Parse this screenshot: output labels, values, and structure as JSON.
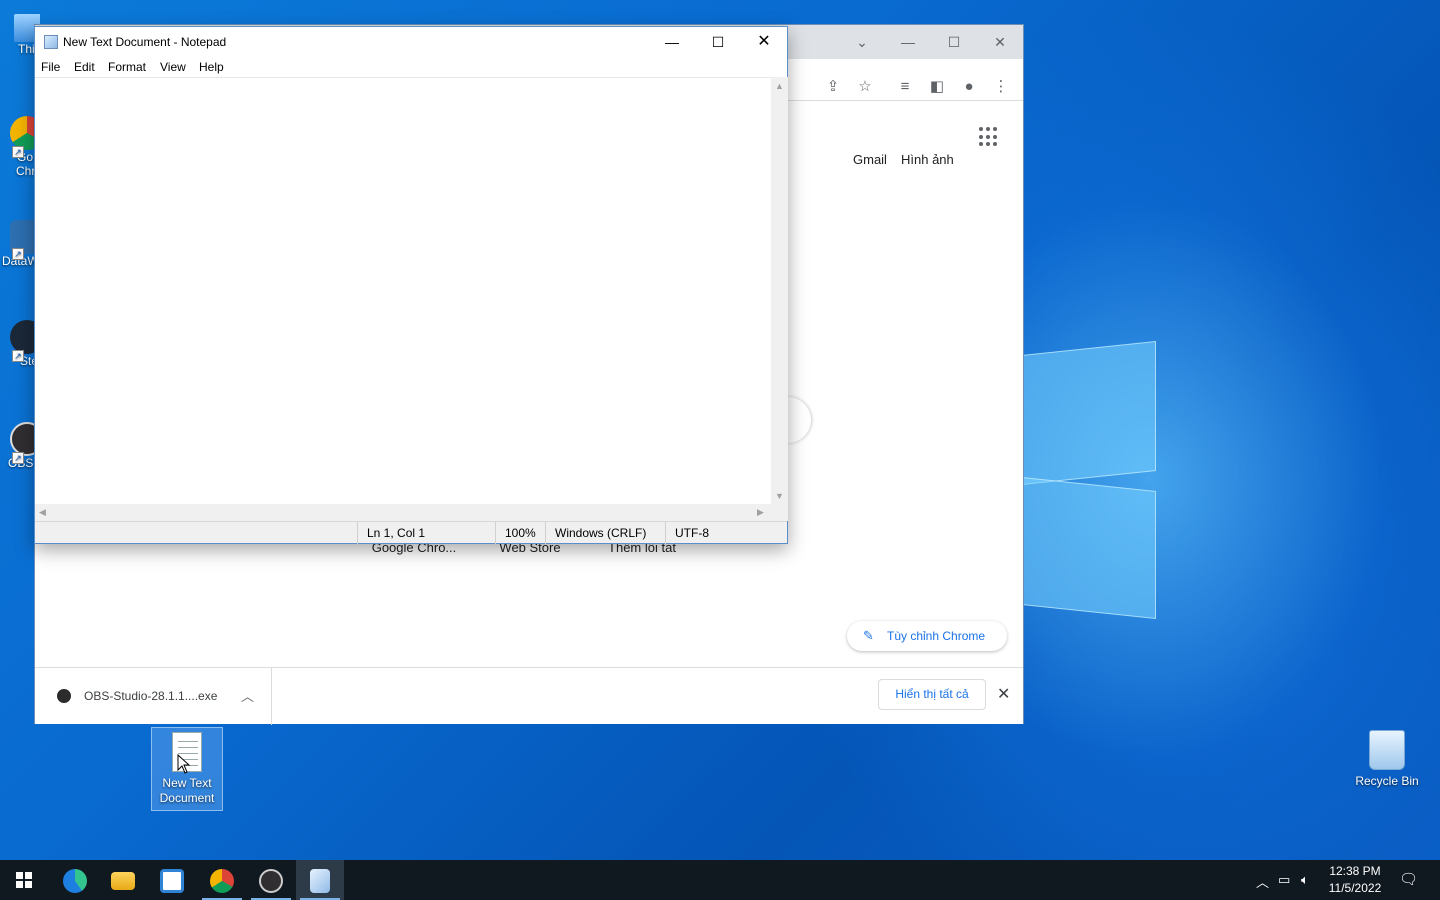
{
  "desktop": {
    "left_icons": [
      {
        "label": "Thi",
        "icon": "this-pc-icon"
      },
      {
        "label": "Go",
        "label2": "Chr",
        "icon": "google-chrome-icon"
      },
      {
        "label": "DataW",
        "icon": "datawrapper-icon"
      },
      {
        "label": "Ste",
        "icon": "steam-icon"
      },
      {
        "label": "OBS",
        "icon": "obs-icon"
      }
    ],
    "recycle_bin": {
      "label": "Recycle Bin"
    },
    "new_text_document": {
      "label": "New Text Document"
    }
  },
  "chrome": {
    "links": {
      "gmail": "Gmail",
      "images": "Hình ảnh"
    },
    "shortcut_labels": [
      "Google Chro...",
      "Web Store",
      "Thêm lối tắt"
    ],
    "customize_label": "Tùy chỉnh Chrome",
    "download": {
      "filename": "OBS-Studio-28.1.1....exe"
    },
    "show_all": "Hiển thị tất cả"
  },
  "notepad": {
    "title": "New Text Document - Notepad",
    "menu": [
      "File",
      "Edit",
      "Format",
      "View",
      "Help"
    ],
    "content": "",
    "status": {
      "position": "Ln 1, Col 1",
      "zoom": "100%",
      "line_ending": "Windows (CRLF)",
      "encoding": "UTF-8"
    }
  },
  "taskbar": {
    "apps": [
      "start-icon",
      "edge-icon",
      "file-explorer-icon",
      "microsoft-store-icon",
      "chrome-icon",
      "obs-icon",
      "notepad-icon"
    ],
    "clock": {
      "time": "12:38 PM",
      "date": "11/5/2022"
    }
  },
  "colors": {
    "accent": "#1a73e8",
    "taskbar": "#101820",
    "desktop": "#0a63c9"
  }
}
